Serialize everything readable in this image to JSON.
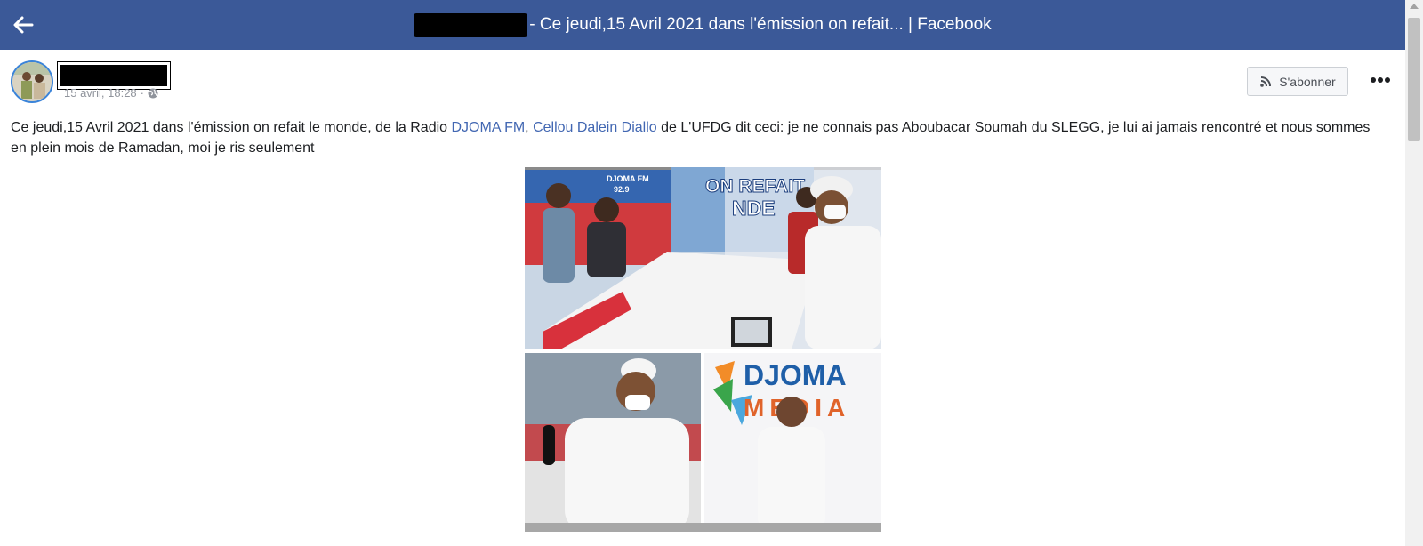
{
  "header": {
    "title": "- Ce jeudi,15 Avril 2021 dans l'émission on refait... | Facebook",
    "back_icon": "back-arrow-icon",
    "bg_color": "#3b5998"
  },
  "post": {
    "time": "15 avril, 18:28",
    "separator": "·",
    "privacy_icon": "globe-icon",
    "subscribe_label": "S'abonner",
    "text": {
      "part1": "Ce jeudi,15 Avril 2021 dans l'émission on refait le monde, de la Radio ",
      "link1": "DJOMA FM",
      "part2": ", ",
      "link2": "Cellou Dalein Diallo",
      "part3": " de L'UFDG dit ceci: je ne connais pas Aboubacar Soumah du SLEGG, je lui ai jamais rencontré et nous sommes en plein mois de Ramadan, moi je ris seulement"
    },
    "photo": {
      "sign_line1": "ON REFAIT",
      "sign_line2": "NDE",
      "logo_badge": "DJOMA FM",
      "logo_badge2": "92.9",
      "logo_line1": "DJOMA",
      "logo_line2": "MEDIA"
    }
  }
}
